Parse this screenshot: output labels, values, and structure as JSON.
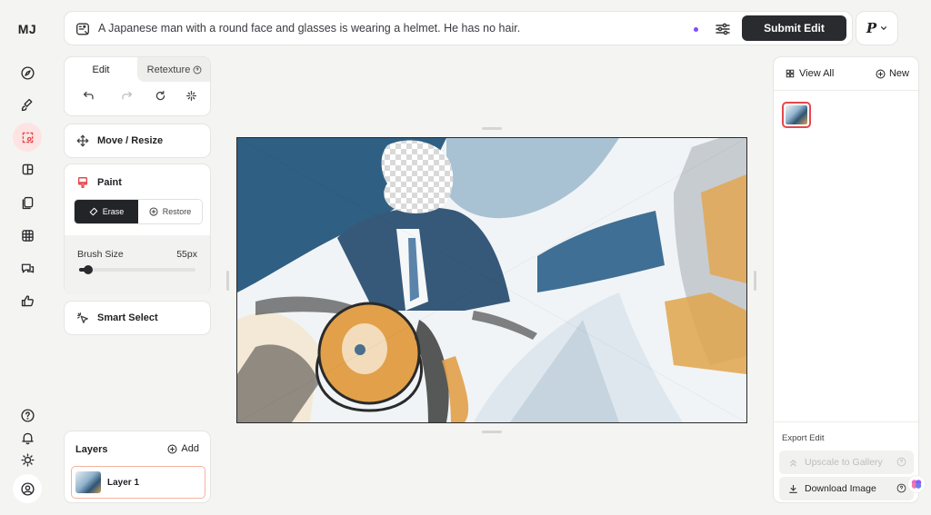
{
  "nav": {
    "logo": "MJ",
    "items": [
      {
        "icon": "compass-icon"
      },
      {
        "icon": "brush-icon"
      },
      {
        "icon": "edit-icon",
        "active": true
      },
      {
        "icon": "organize-icon"
      },
      {
        "icon": "personalize-icon"
      },
      {
        "icon": "grid-icon"
      },
      {
        "icon": "chat-icon"
      },
      {
        "icon": "thumbs-up-icon"
      }
    ],
    "bottom": [
      {
        "icon": "help-icon"
      },
      {
        "icon": "bell-icon"
      },
      {
        "icon": "sun-icon"
      },
      {
        "icon": "account-icon"
      }
    ]
  },
  "prompt": {
    "text": "A Japanese man with a round face and glasses is wearing a helmet. He has no hair.",
    "submit_label": "Submit Edit",
    "profile_label": "P"
  },
  "tools": {
    "tab_edit": "Edit",
    "tab_retexture": "Retexture",
    "move_resize": "Move / Resize",
    "paint": "Paint",
    "erase": "Erase",
    "restore": "Restore",
    "brush_size_label": "Brush Size",
    "brush_size_value": "55px",
    "brush_size_fraction": 0.08,
    "smart_select": "Smart Select"
  },
  "layers": {
    "title": "Layers",
    "add_label": "Add",
    "items": [
      {
        "name": "Layer 1"
      }
    ]
  },
  "right_panel": {
    "view_all": "View All",
    "new_label": "New",
    "export_label": "Export Edit",
    "upscale_label": "Upscale to Gallery",
    "download_label": "Download Image"
  },
  "colors": {
    "accent": "#e5484d",
    "dark": "#2a2b2f",
    "purple_dot": "#7c4dff"
  }
}
